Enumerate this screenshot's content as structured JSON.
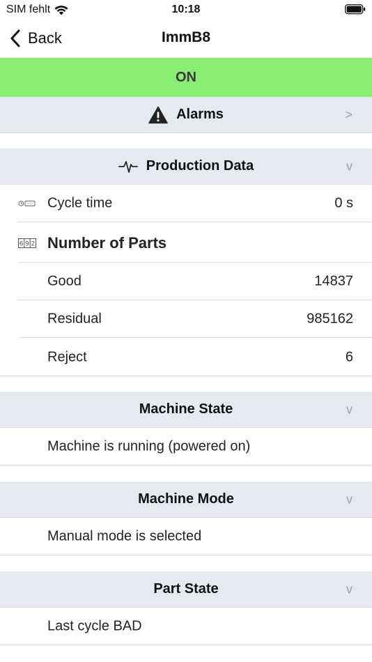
{
  "status_bar": {
    "carrier": "SIM fehlt",
    "time": "10:18"
  },
  "nav": {
    "back_label": "Back",
    "title": "ImmB8"
  },
  "state_banner": {
    "label": "ON",
    "color": "#8aee74"
  },
  "alarms": {
    "label": "Alarms",
    "chevron": ">"
  },
  "production": {
    "header": "Production Data",
    "chevron": "v",
    "cycle_time": {
      "label": "Cycle time",
      "value": "0 s"
    },
    "parts_heading": "Number of Parts",
    "good": {
      "label": "Good",
      "value": "14837"
    },
    "residual": {
      "label": "Residual",
      "value": "985162"
    },
    "reject": {
      "label": "Reject",
      "value": "6"
    }
  },
  "machine_state": {
    "header": "Machine State",
    "chevron": "v",
    "text": "Machine is running (powered on)"
  },
  "machine_mode": {
    "header": "Machine Mode",
    "chevron": "v",
    "text": "Manual mode is selected"
  },
  "part_state": {
    "header": "Part State",
    "chevron": "v",
    "text": "Last cycle BAD"
  },
  "icons": {
    "wifi": "wifi-icon",
    "battery": "battery-icon",
    "back": "chevron-left-icon",
    "alarm": "warning-triangle-icon",
    "production": "pulse-icon",
    "cycle": "cycle-time-icon",
    "counter": "counter-icon"
  }
}
